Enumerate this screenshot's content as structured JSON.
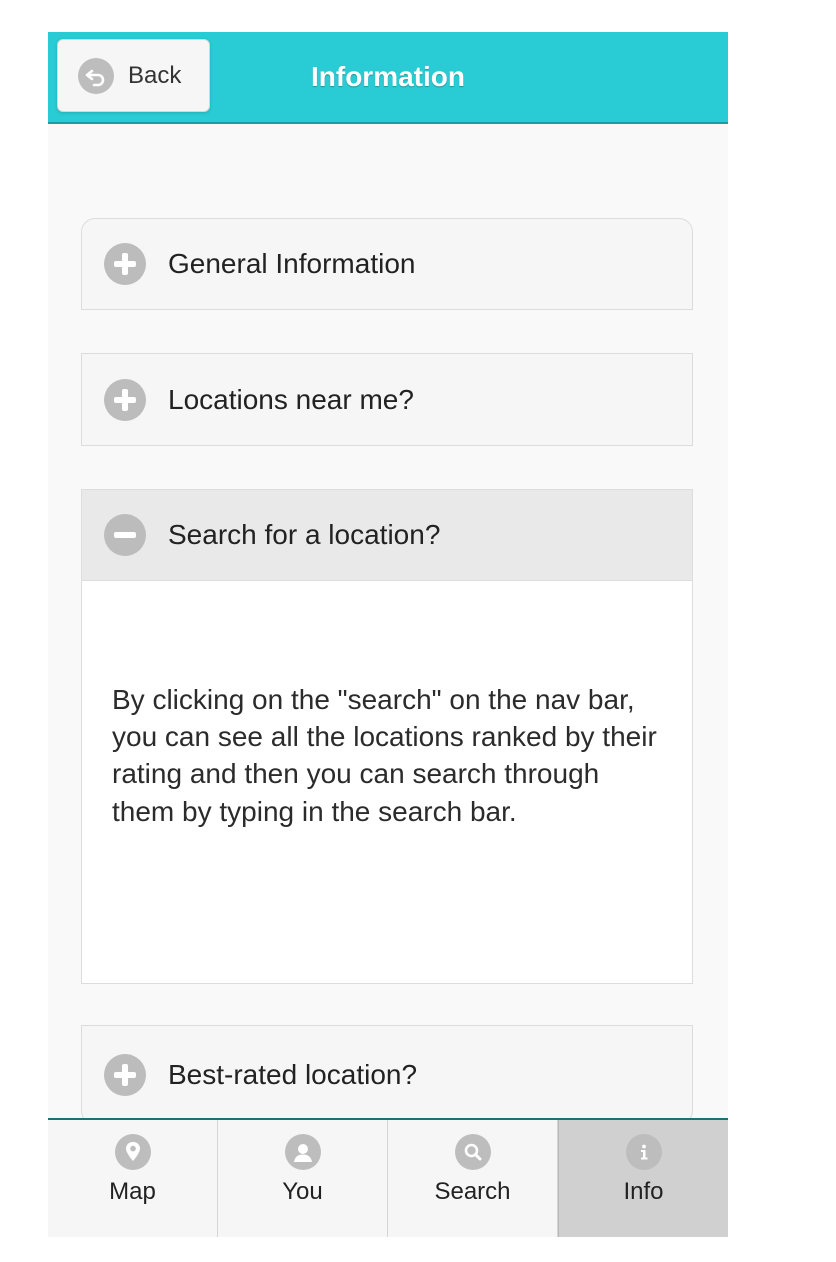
{
  "header": {
    "title": "Information",
    "back_label": "Back"
  },
  "accordion": [
    {
      "label": "General Information",
      "expanded": false
    },
    {
      "label": "Locations near me?",
      "expanded": false
    },
    {
      "label": "Search for a location?",
      "expanded": true,
      "body": "By clicking on the \"search\" on the nav bar, you can see all the locations ranked by their rating and then you can search through them by typing in the search bar."
    },
    {
      "label": "Best-rated location?",
      "expanded": false
    }
  ],
  "tabbar": {
    "tabs": [
      {
        "label": "Map",
        "icon": "map-pin-icon",
        "active": false
      },
      {
        "label": "You",
        "icon": "user-icon",
        "active": false
      },
      {
        "label": "Search",
        "icon": "search-icon",
        "active": false
      },
      {
        "label": "Info",
        "icon": "info-icon",
        "active": true
      }
    ]
  },
  "colors": {
    "header_bg": "#29cbd4",
    "icon_gray": "#bdbdbd",
    "active_tab_bg": "#d0d0d0"
  }
}
